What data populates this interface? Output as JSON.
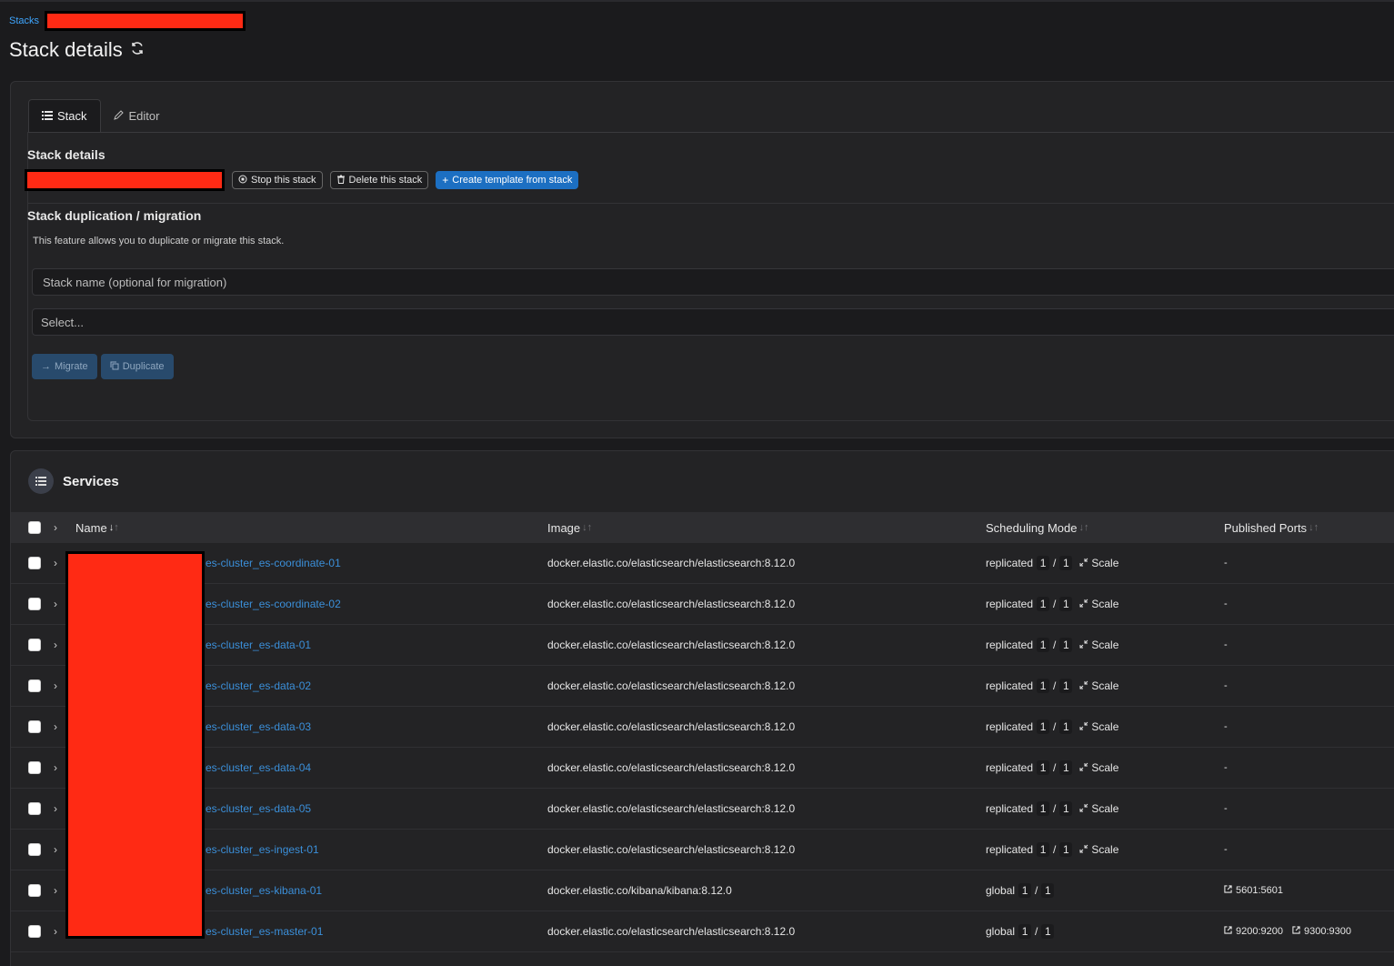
{
  "breadcrumb": {
    "root": "Stacks"
  },
  "page": {
    "title": "Stack details"
  },
  "tabs": [
    {
      "label": "Stack"
    },
    {
      "label": "Editor"
    }
  ],
  "stack_details": {
    "heading": "Stack details",
    "buttons": {
      "stop": "Stop this stack",
      "delete": "Delete this stack",
      "create_template": "Create template from stack"
    }
  },
  "migration": {
    "heading": "Stack duplication / migration",
    "help": "This feature allows you to duplicate or migrate this stack.",
    "name_placeholder": "Stack name (optional for migration)",
    "select_placeholder": "Select...",
    "migrate_label": "Migrate",
    "duplicate_label": "Duplicate"
  },
  "services": {
    "title": "Services",
    "columns": {
      "name": "Name",
      "image": "Image",
      "scheduling": "Scheduling Mode",
      "ports": "Published Ports"
    },
    "scale_label": "Scale",
    "rows": [
      {
        "name": "es-cluster_es-coordinate-01",
        "image": "docker.elastic.co/elasticsearch/elasticsearch:8.12.0",
        "mode": "replicated",
        "running": "1",
        "slash": "/",
        "desired": "1",
        "ports": [
          "-"
        ]
      },
      {
        "name": "es-cluster_es-coordinate-02",
        "image": "docker.elastic.co/elasticsearch/elasticsearch:8.12.0",
        "mode": "replicated",
        "running": "1",
        "slash": "/",
        "desired": "1",
        "ports": [
          "-"
        ]
      },
      {
        "name": "es-cluster_es-data-01",
        "image": "docker.elastic.co/elasticsearch/elasticsearch:8.12.0",
        "mode": "replicated",
        "running": "1",
        "slash": "/",
        "desired": "1",
        "ports": [
          "-"
        ]
      },
      {
        "name": "es-cluster_es-data-02",
        "image": "docker.elastic.co/elasticsearch/elasticsearch:8.12.0",
        "mode": "replicated",
        "running": "1",
        "slash": "/",
        "desired": "1",
        "ports": [
          "-"
        ]
      },
      {
        "name": "es-cluster_es-data-03",
        "image": "docker.elastic.co/elasticsearch/elasticsearch:8.12.0",
        "mode": "replicated",
        "running": "1",
        "slash": "/",
        "desired": "1",
        "ports": [
          "-"
        ]
      },
      {
        "name": "es-cluster_es-data-04",
        "image": "docker.elastic.co/elasticsearch/elasticsearch:8.12.0",
        "mode": "replicated",
        "running": "1",
        "slash": "/",
        "desired": "1",
        "ports": [
          "-"
        ]
      },
      {
        "name": "es-cluster_es-data-05",
        "image": "docker.elastic.co/elasticsearch/elasticsearch:8.12.0",
        "mode": "replicated",
        "running": "1",
        "slash": "/",
        "desired": "1",
        "ports": [
          "-"
        ]
      },
      {
        "name": "es-cluster_es-ingest-01",
        "image": "docker.elastic.co/elasticsearch/elasticsearch:8.12.0",
        "mode": "replicated",
        "running": "1",
        "slash": "/",
        "desired": "1",
        "ports": [
          "-"
        ]
      },
      {
        "name": "es-cluster_es-kibana-01",
        "image": "docker.elastic.co/kibana/kibana:8.12.0",
        "mode": "global",
        "running": "1",
        "slash": "/",
        "desired": "1",
        "ports": [
          "5601:5601"
        ]
      },
      {
        "name": "es-cluster_es-master-01",
        "image": "docker.elastic.co/elasticsearch/elasticsearch:8.12.0",
        "mode": "global",
        "running": "1",
        "slash": "/",
        "desired": "1",
        "ports": [
          "9200:9200",
          "9300:9300"
        ]
      }
    ]
  }
}
